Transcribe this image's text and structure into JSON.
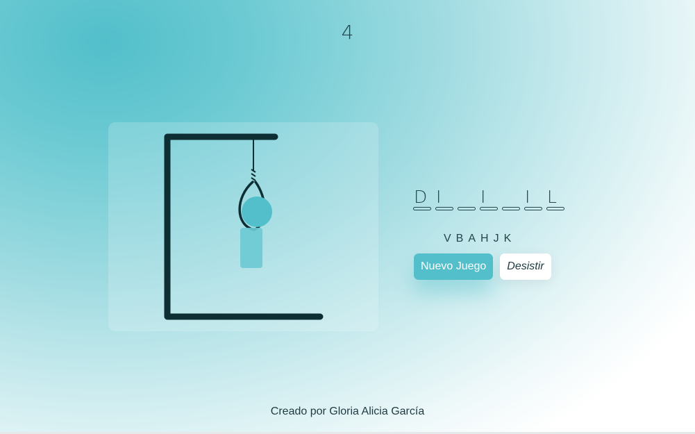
{
  "game": {
    "attempts_left": "4",
    "word_slots": [
      "D",
      "I",
      "",
      "I",
      "",
      "I",
      "L"
    ],
    "used_letters": [
      "V",
      "B",
      "A",
      "H",
      "J",
      "K"
    ]
  },
  "buttons": {
    "new_game": "Nuevo Juego",
    "give_up": "Desistir"
  },
  "footer": {
    "credit": "Creado por Gloria Alicia García"
  },
  "colors": {
    "accent": "#52bfca",
    "gallows": "#0d2e33",
    "body_part": "#6ccad3"
  }
}
